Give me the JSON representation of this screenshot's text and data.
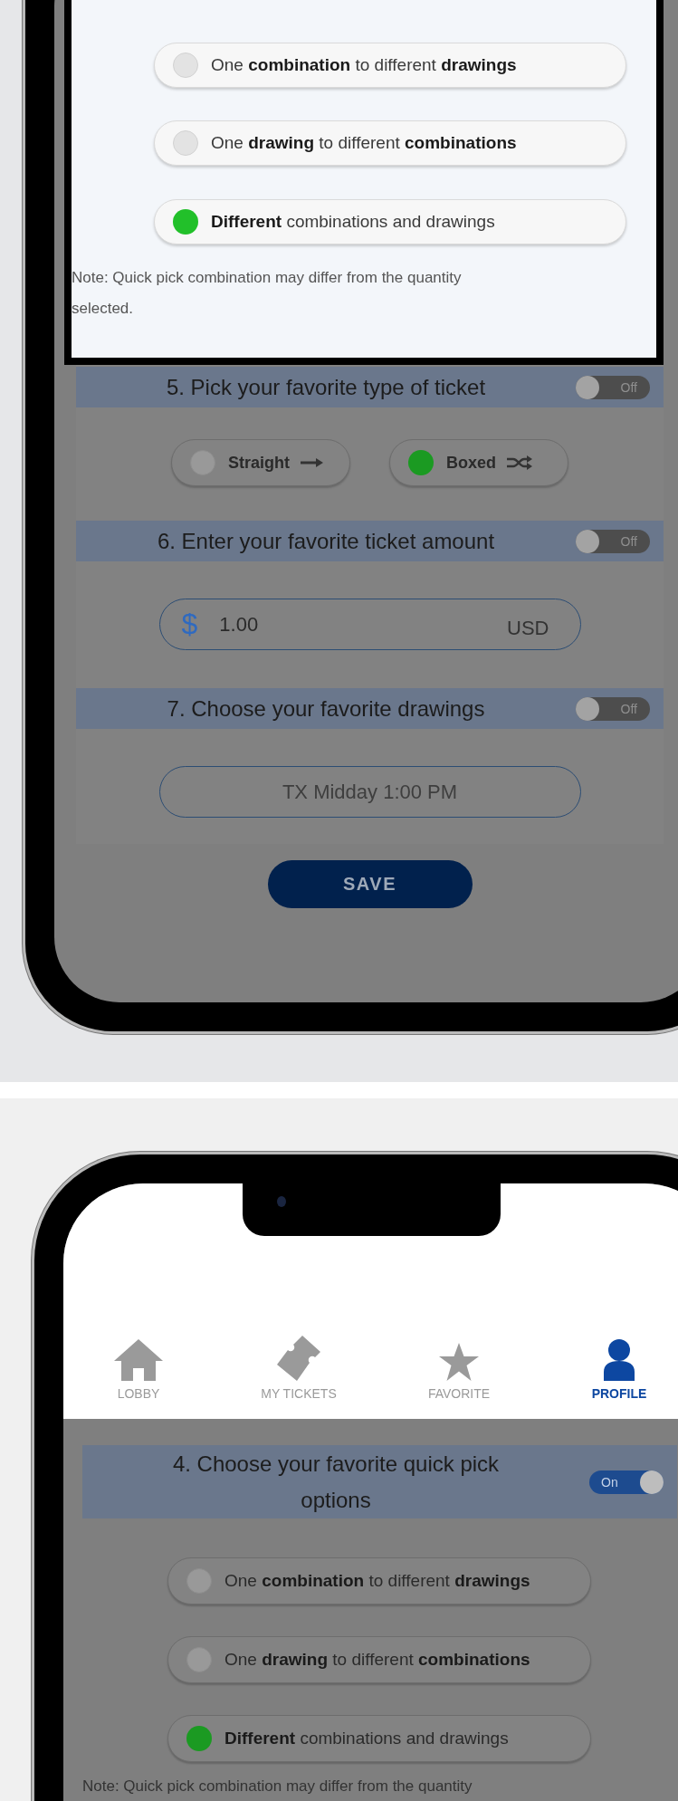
{
  "quick_pick_popup": {
    "options": [
      {
        "label": "One **combination** to different **drawings**",
        "selected": false
      },
      {
        "label": "One **drawing** to different **combinations**",
        "selected": false
      },
      {
        "label": "**Different** combinations and drawings",
        "selected": true
      }
    ],
    "note": "Note: Quick pick combination may differ from the quantity selected."
  },
  "sections": [
    {
      "kind": "ticket_type",
      "title": "5. Pick your favorite type of ticket",
      "on": false,
      "toggle_label": "Off",
      "options": [
        {
          "label": "Straight",
          "selected": false
        },
        {
          "label": "Boxed",
          "selected": true
        }
      ]
    },
    {
      "kind": "amount",
      "title": "6. Enter your favorite ticket amount",
      "on": false,
      "toggle_label": "Off",
      "symbol": "$",
      "value": "1.00",
      "currency": "USD"
    },
    {
      "kind": "drawings",
      "title": "7. Choose your favorite drawings",
      "on": false,
      "toggle_label": "Off",
      "placeholder": "TX Midday 1:00 PM"
    }
  ],
  "save_button": "SAVE",
  "second_screen": {
    "nav": [
      {
        "label": "LOBBY",
        "selected": false
      },
      {
        "label": "MY TICKETS",
        "selected": false
      },
      {
        "label": "FAVORITE",
        "selected": false
      },
      {
        "label": "PROFILE",
        "selected": true
      }
    ],
    "section": {
      "title": "4. Choose your favorite quick pick options",
      "on": true,
      "toggle_label": "On",
      "options": [
        {
          "label": "One **combination** to different **drawings**",
          "selected": false
        },
        {
          "label": "One **drawing** to different **combinations**",
          "selected": false
        },
        {
          "label": "**Different** combinations and drawings",
          "selected": true
        }
      ],
      "note": "Note: Quick pick combination may differ from the quantity"
    }
  }
}
